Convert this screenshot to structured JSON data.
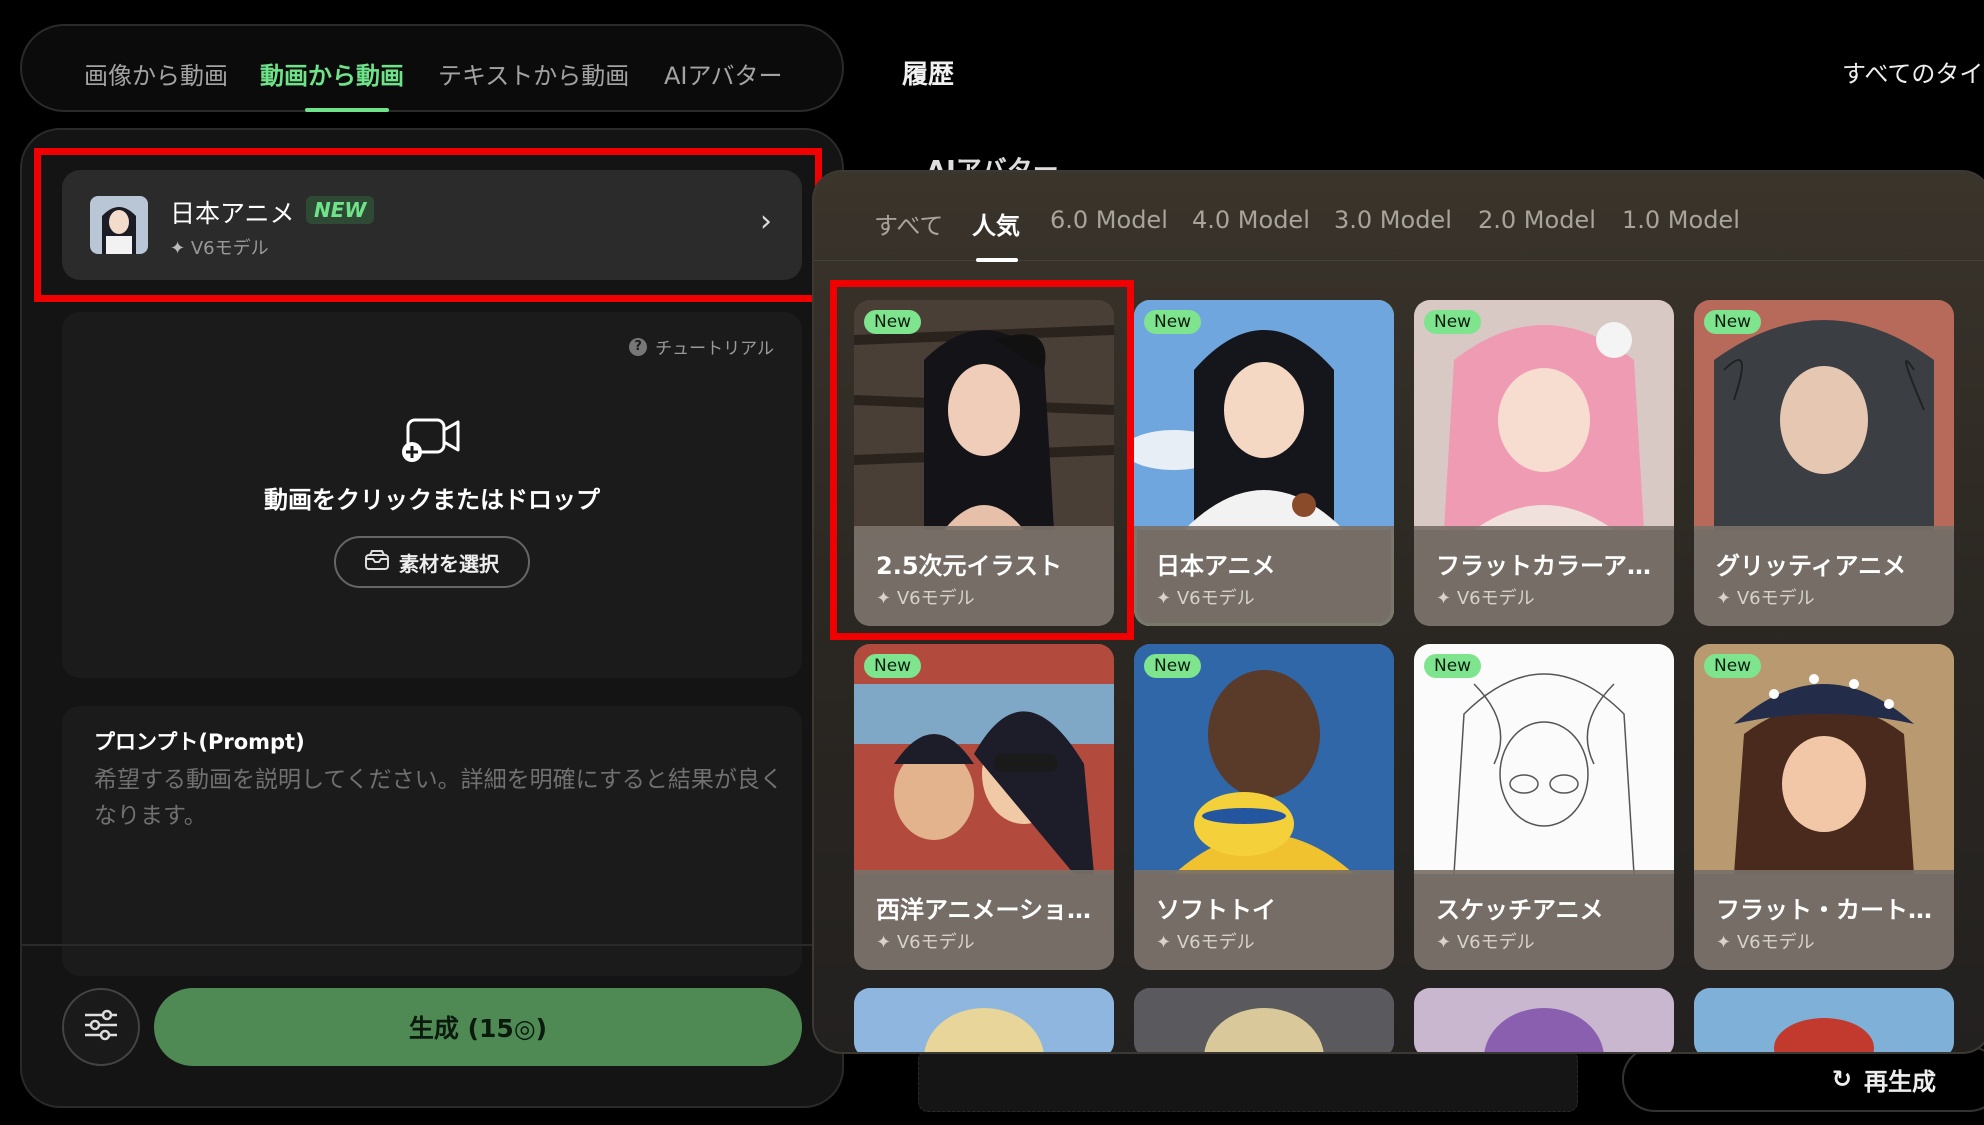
{
  "tabs": {
    "items": [
      "画像から動画",
      "動画から動画",
      "テキストから動画",
      "AIアバター"
    ],
    "active_index": 1
  },
  "history": {
    "title": "履歴",
    "filter_label": "すべてのタイ",
    "section_label": "AIアバター"
  },
  "selected_model": {
    "name": "日本アニメ",
    "badge": "NEW",
    "sub": "V6モデル"
  },
  "upload": {
    "tutorial": "チュートリアル",
    "text": "動画をクリックまたはドロップ",
    "select_button": "素材を選択"
  },
  "prompt": {
    "label": "プロンプト(Prompt)",
    "placeholder": "希望する動画を説明してください。詳細を明確にすると結果が良くなります。"
  },
  "generate_button": "生成 (15◎)",
  "regenerate_button": "再生成",
  "popup": {
    "tabs": [
      "すべて",
      "人気",
      "6.0 Model",
      "4.0 Model",
      "3.0 Model",
      "2.0 Model",
      "1.0 Model"
    ],
    "active_tab": 1,
    "styles": [
      {
        "name": "2.5次元イラスト",
        "sub": "V6モデル",
        "badge": "New"
      },
      {
        "name": "日本アニメ",
        "sub": "V6モデル",
        "badge": "New"
      },
      {
        "name": "フラットカラーア…",
        "sub": "V6モデル",
        "badge": "New"
      },
      {
        "name": "グリッティアニメ",
        "sub": "V6モデル",
        "badge": "New"
      },
      {
        "name": "西洋アニメーショ…",
        "sub": "V6モデル",
        "badge": "New"
      },
      {
        "name": "ソフトトイ",
        "sub": "V6モデル",
        "badge": "New"
      },
      {
        "name": "スケッチアニメ",
        "sub": "V6モデル",
        "badge": "New"
      },
      {
        "name": "フラット・カート…",
        "sub": "V6モデル",
        "badge": "New"
      }
    ]
  },
  "colors": {
    "accent": "#6fe38a",
    "highlight": "#f00000",
    "generate": "#4f8a55"
  }
}
